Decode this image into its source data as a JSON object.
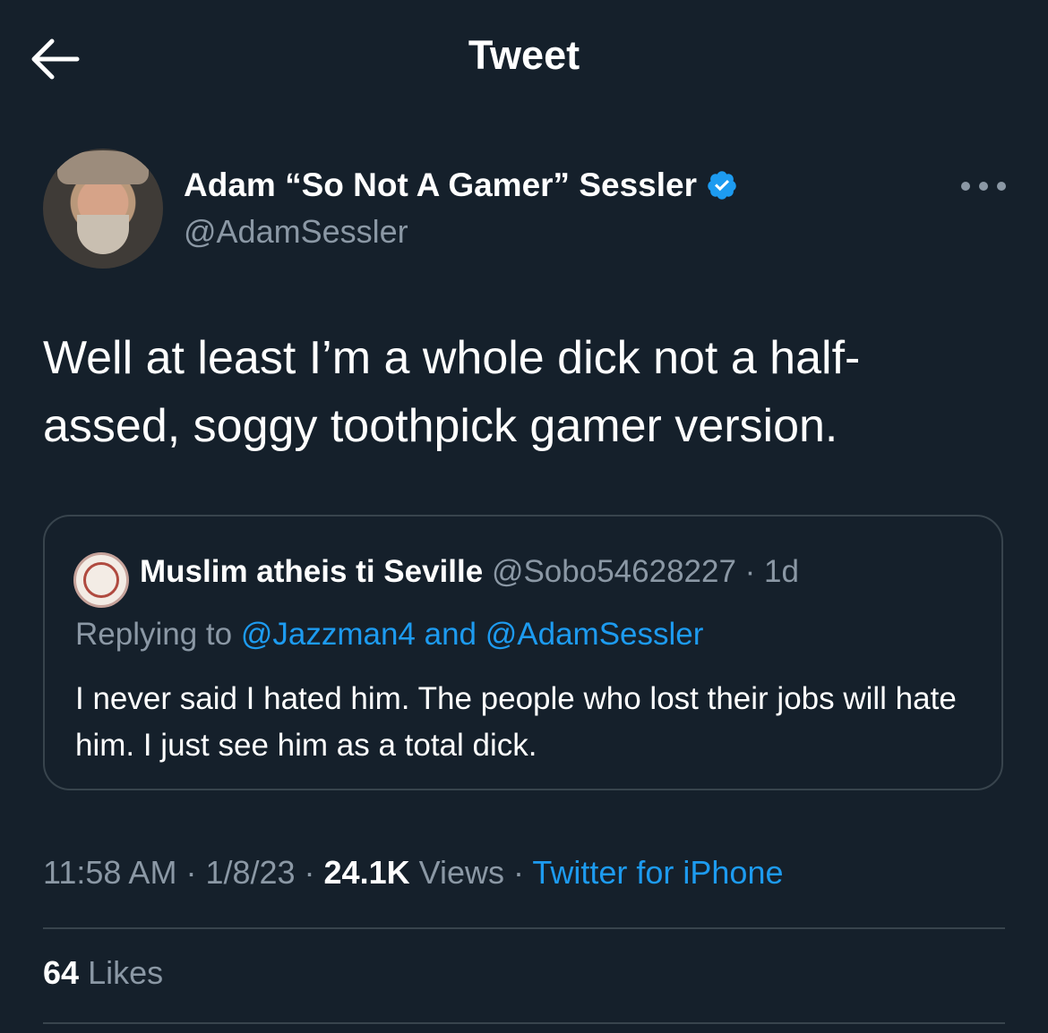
{
  "header": {
    "title": "Tweet",
    "back_icon": "arrow-left-icon"
  },
  "tweet": {
    "author": {
      "display_name": "Adam “So Not A Gamer” Sessler",
      "handle": "@AdamSessler",
      "verified": true
    },
    "text": "Well at least I’m a whole dick not a half-\nassed, soggy toothpick gamer version.",
    "time": "11:58 AM",
    "date": "1/8/23",
    "views_count": "24.1K",
    "views_label": "Views",
    "source": "Twitter for iPhone",
    "likes_count": "64",
    "likes_label": "Likes",
    "separator": " · "
  },
  "quoted_tweet": {
    "author_name": "Muslim atheis ti Seville",
    "author_handle": "@Sobo54628227",
    "age": "1d",
    "replying_prefix": "Replying to ",
    "reply_to_1": "@Jazzman4",
    "reply_and": " and ",
    "reply_to_2": "@AdamSessler",
    "text": "I never said I hated him. The people who lost their jobs will hate him. I just see him as a total dick."
  },
  "colors": {
    "background": "#15202b",
    "text_primary": "#ffffff",
    "text_secondary": "#8b98a5",
    "accent": "#1d9bf0",
    "border": "#38444d"
  }
}
